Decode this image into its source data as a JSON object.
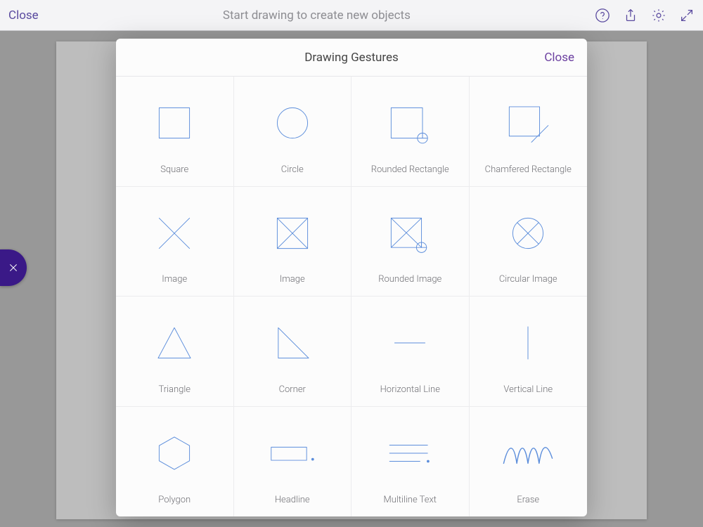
{
  "toolbar": {
    "close_label": "Close",
    "title": "Start drawing to create new objects"
  },
  "modal": {
    "title": "Drawing Gestures",
    "close_label": "Close"
  },
  "gestures": [
    {
      "name": "square",
      "label": "Square"
    },
    {
      "name": "circle",
      "label": "Circle"
    },
    {
      "name": "rounded-rectangle",
      "label": "Rounded Rectangle"
    },
    {
      "name": "chamfered-rectangle",
      "label": "Chamfered Rectangle"
    },
    {
      "name": "image",
      "label": "Image"
    },
    {
      "name": "image-boxed",
      "label": "Image"
    },
    {
      "name": "rounded-image",
      "label": "Rounded Image"
    },
    {
      "name": "circular-image",
      "label": "Circular Image"
    },
    {
      "name": "triangle",
      "label": "Triangle"
    },
    {
      "name": "corner",
      "label": "Corner"
    },
    {
      "name": "horizontal-line",
      "label": "Horizontal Line"
    },
    {
      "name": "vertical-line",
      "label": "Vertical Line"
    },
    {
      "name": "polygon",
      "label": "Polygon"
    },
    {
      "name": "headline",
      "label": "Headline"
    },
    {
      "name": "multiline-text",
      "label": "Multiline Text"
    },
    {
      "name": "erase",
      "label": "Erase"
    }
  ]
}
